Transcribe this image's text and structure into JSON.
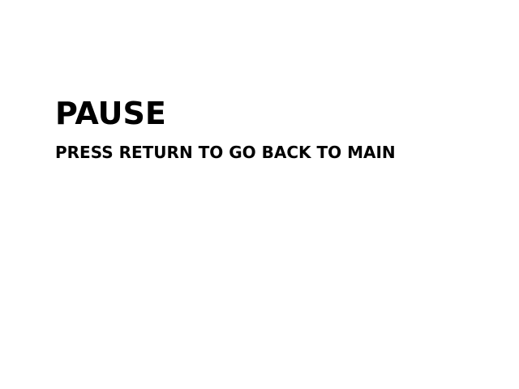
{
  "screen": {
    "background_color": "#ffffff",
    "text_color": "#000000"
  },
  "pause_menu": {
    "title": "PAUSE",
    "hint": "PRESS RETURN TO GO BACK TO MAIN"
  }
}
